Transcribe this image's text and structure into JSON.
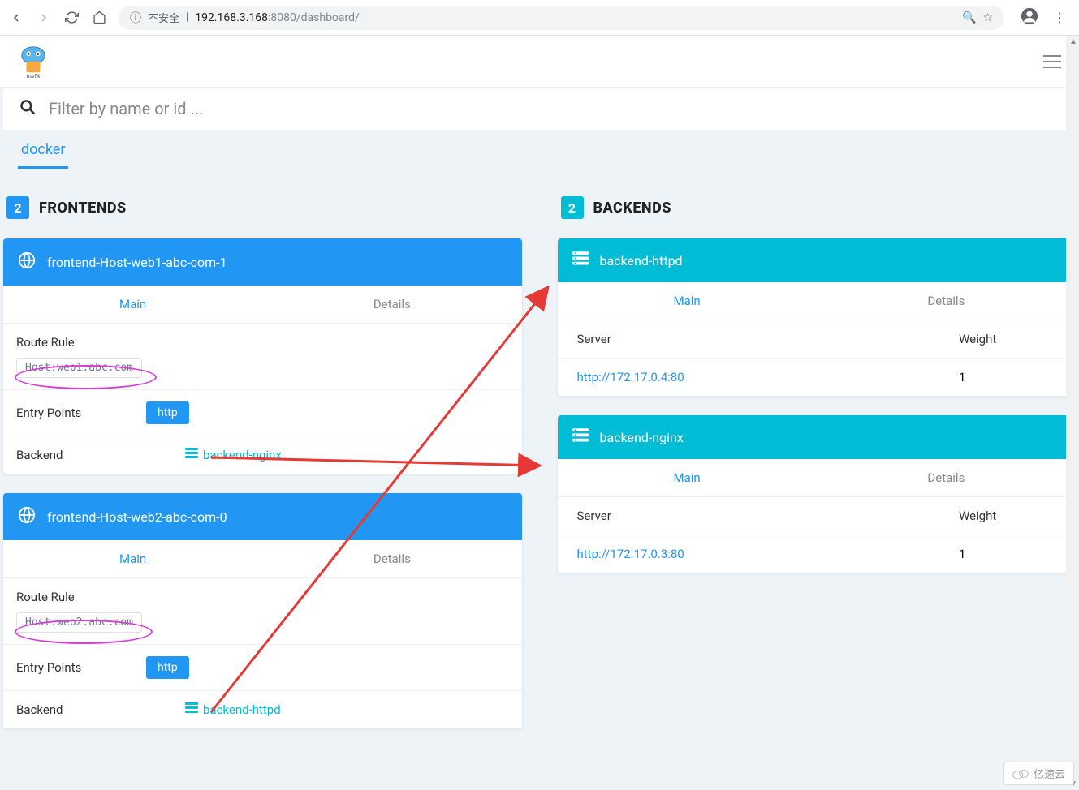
{
  "browser": {
    "security_label": "不安全",
    "url_host": "192.168.3.168",
    "url_port": ":8080",
    "url_path": "/dashboard/"
  },
  "search": {
    "placeholder": "Filter by name or id ..."
  },
  "provider_tab": "docker",
  "frontends": {
    "count": "2",
    "title": "FRONTENDS",
    "tab_main": "Main",
    "tab_details": "Details",
    "label_route": "Route Rule",
    "label_entry": "Entry Points",
    "label_backend": "Backend",
    "items": [
      {
        "name": "frontend-Host-web1-abc-com-1",
        "rule": "Host:web1.abc.com",
        "entry": "http",
        "backend": "backend-nginx"
      },
      {
        "name": "frontend-Host-web2-abc-com-0",
        "rule": "Host:web2.abc.com",
        "entry": "http",
        "backend": "backend-httpd"
      }
    ]
  },
  "backends": {
    "count": "2",
    "title": "BACKENDS",
    "tab_main": "Main",
    "tab_details": "Details",
    "col_server": "Server",
    "col_weight": "Weight",
    "items": [
      {
        "name": "backend-httpd",
        "server": "http://172.17.0.4:80",
        "weight": "1"
      },
      {
        "name": "backend-nginx",
        "server": "http://172.17.0.3:80",
        "weight": "1"
      }
    ]
  },
  "watermark": "亿速云"
}
